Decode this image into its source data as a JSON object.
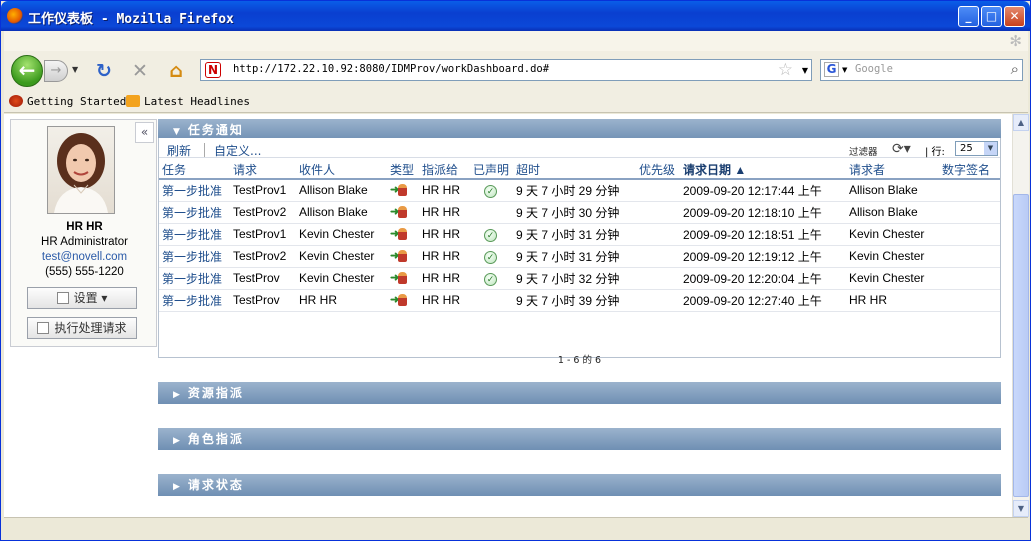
{
  "window": {
    "title": "工作仪表板 - Mozilla Firefox",
    "min_label": "_",
    "max_label": "□",
    "close_label": "✕"
  },
  "nav": {
    "back_icon": "←",
    "forward_icon": "→",
    "reload_icon": "↻",
    "stop_icon": "✕",
    "home_icon": "⌂",
    "url": "http://172.22.10.92:8080/IDMProv/workDashboard.do#",
    "site_icon_letter": "N",
    "bookmark_star": "☆",
    "search_engine_letter": "G",
    "search_placeholder": "Google",
    "search_icon": "⌕"
  },
  "bookmarks": [
    {
      "label": "Getting Started",
      "icon": "firefox-icon"
    },
    {
      "label": "Latest Headlines",
      "icon": "rss-icon"
    }
  ],
  "profile": {
    "collapse_icon": "«",
    "name": "HR HR",
    "title": "HR Administrator",
    "email": "test@novell.com",
    "phone": "(555) 555-1220",
    "settings_label": "设置 ▾",
    "process_label": "执行处理请求"
  },
  "task_section": {
    "title": "任务通知",
    "refresh_label": "刷新",
    "customize_label": "自定义...",
    "filter_label": "过滤器",
    "refresh_icon": "⟳▾",
    "rows_label": "| 行:",
    "rows_value": "25",
    "columns": [
      "任务",
      "请求",
      "收件人",
      "类型",
      "指派给",
      "已声明",
      "超时",
      "优先级",
      "请求日期 ▲",
      "请求者",
      "数字签名"
    ],
    "rows": [
      {
        "task": "第一步批准",
        "request": "TestProv1",
        "recipient": "Allison Blake",
        "assigned": "HR HR",
        "claimed": true,
        "timeout": "9 天 7 小时 29 分钟",
        "priority": "",
        "date": "2009-09-20 12:17:44 上午",
        "requester": "Allison Blake",
        "signature": ""
      },
      {
        "task": "第一步批准",
        "request": "TestProv2",
        "recipient": "Allison Blake",
        "assigned": "HR HR",
        "claimed": false,
        "timeout": "9 天 7 小时 30 分钟",
        "priority": "",
        "date": "2009-09-20 12:18:10 上午",
        "requester": "Allison Blake",
        "signature": ""
      },
      {
        "task": "第一步批准",
        "request": "TestProv1",
        "recipient": "Kevin Chester",
        "assigned": "HR HR",
        "claimed": true,
        "timeout": "9 天 7 小时 31 分钟",
        "priority": "",
        "date": "2009-09-20 12:18:51 上午",
        "requester": "Kevin Chester",
        "signature": ""
      },
      {
        "task": "第一步批准",
        "request": "TestProv2",
        "recipient": "Kevin Chester",
        "assigned": "HR HR",
        "claimed": true,
        "timeout": "9 天 7 小时 31 分钟",
        "priority": "",
        "date": "2009-09-20 12:19:12 上午",
        "requester": "Kevin Chester",
        "signature": ""
      },
      {
        "task": "第一步批准",
        "request": "TestProv",
        "recipient": "Kevin Chester",
        "assigned": "HR HR",
        "claimed": true,
        "timeout": "9 天 7 小时 32 分钟",
        "priority": "",
        "date": "2009-09-20 12:20:04 上午",
        "requester": "Kevin Chester",
        "signature": ""
      },
      {
        "task": "第一步批准",
        "request": "TestProv",
        "recipient": "HR HR",
        "assigned": "HR HR",
        "claimed": false,
        "timeout": "9 天 7 小时 39 分钟",
        "priority": "",
        "date": "2009-09-20 12:27:40 上午",
        "requester": "HR HR",
        "signature": ""
      }
    ],
    "pager": "1 - 6 的 6"
  },
  "sections": [
    {
      "title": "资源指派"
    },
    {
      "title": "角色指派"
    },
    {
      "title": "请求状态"
    }
  ],
  "colors": {
    "title_bar": "#0a46d6",
    "section_header": "#7f9bbd",
    "link": "#1f4e8c"
  }
}
